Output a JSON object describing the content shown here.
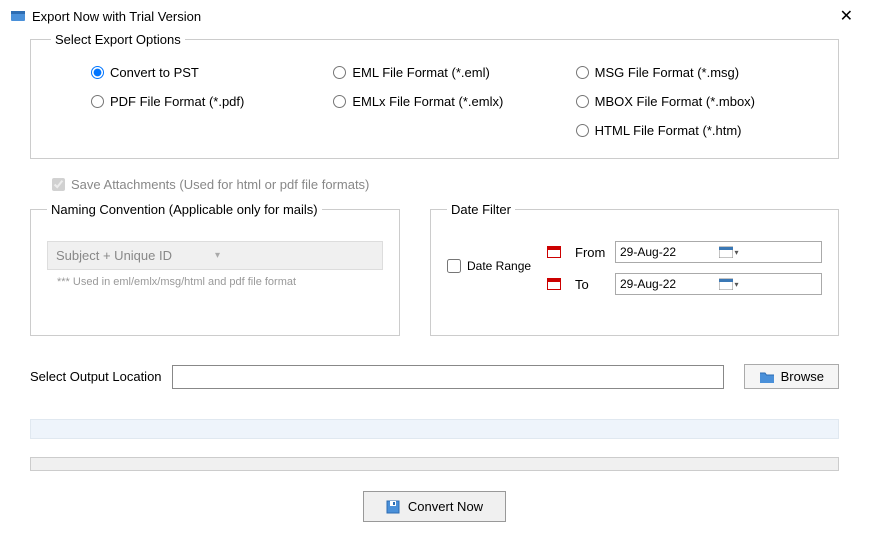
{
  "window": {
    "title": "Export Now with Trial Version"
  },
  "export_options": {
    "legend": "Select Export Options",
    "items": [
      {
        "label": "Convert to PST",
        "checked": true
      },
      {
        "label": "EML File  Format (*.eml)",
        "checked": false
      },
      {
        "label": "MSG File Format (*.msg)",
        "checked": false
      },
      {
        "label": "PDF File Format (*.pdf)",
        "checked": false
      },
      {
        "label": "EMLx File  Format (*.emlx)",
        "checked": false
      },
      {
        "label": "MBOX File Format (*.mbox)",
        "checked": false
      },
      {
        "label": "HTML File  Format (*.htm)",
        "checked": false
      }
    ]
  },
  "save_attachments": {
    "label": "Save Attachments (Used for html or pdf file formats)",
    "checked": true,
    "disabled": true
  },
  "naming": {
    "legend": "Naming Convention (Applicable only for mails)",
    "selected": "Subject + Unique ID",
    "hint": "*** Used in eml/emlx/msg/html and pdf file format"
  },
  "date_filter": {
    "legend": "Date Filter",
    "range_label": "Date Range",
    "range_checked": false,
    "from_label": "From",
    "from_value": "29-Aug-22",
    "to_label": "To",
    "to_value": "29-Aug-22"
  },
  "output": {
    "label": "Select Output Location",
    "value": "",
    "browse_label": "Browse"
  },
  "convert_label": "Convert Now"
}
